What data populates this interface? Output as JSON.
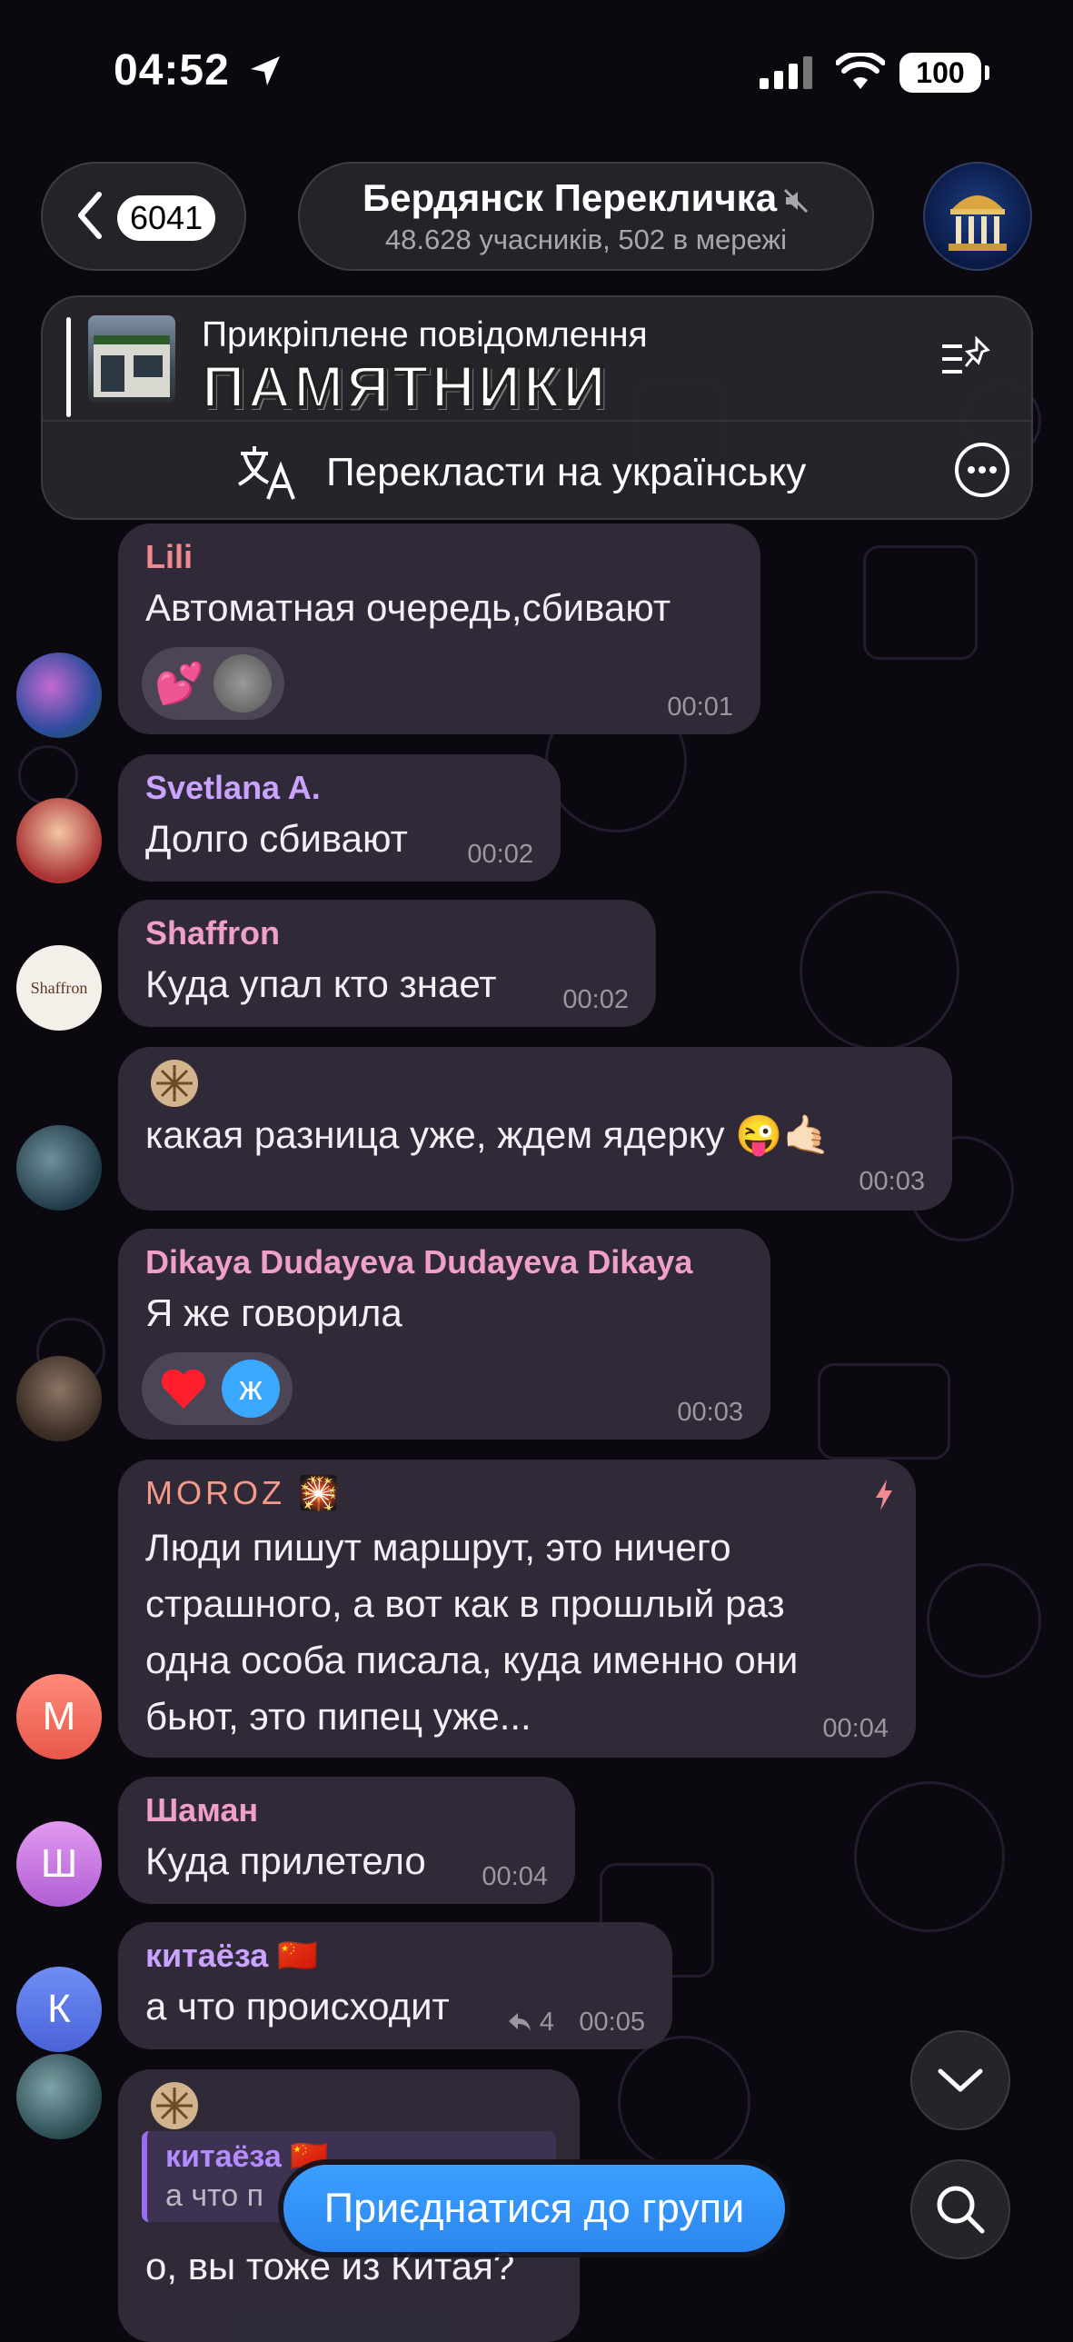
{
  "status": {
    "time": "04:52",
    "battery": "100"
  },
  "header": {
    "back_count": "6041",
    "title": "Бердянск Перекличка",
    "subtitle": "48.628 учасників, 502 в мережі"
  },
  "pinned": {
    "title": "Прикріплене повідомлення",
    "text": "ПАМЯТНИКИ",
    "translate": "Перекласти на українську"
  },
  "messages": [
    {
      "sender": "Lili",
      "text": "Автоматная очередь,сбивают",
      "time": "00:01",
      "sender_color": "#f08a8f"
    },
    {
      "sender": "Svetlana A.",
      "text": "Долго сбивают",
      "time": "00:02",
      "sender_color": "#c9a3ff"
    },
    {
      "sender": "Shaffron",
      "text": "Куда упал кто знает",
      "time": "00:02",
      "sender_color": "#f0a0c8",
      "avatar_text": "Shaffron"
    },
    {
      "sender": "",
      "text": "какая разница уже, ждем ядерку 😜🤙🏻",
      "time": "00:03"
    },
    {
      "sender": "Dikaya Dudayeva Dudayeva Dikaya",
      "text": "Я же говорила",
      "time": "00:03",
      "sender_color": "#f0a0c8",
      "reaction_letter": "ж"
    },
    {
      "sender": "MOROZ",
      "text_lines": [
        "Люди пишут маршрут, это ничего",
        "страшного, а вот как в прошлый раз",
        "одна особа писала, куда именно они",
        "бьют, это пипец уже..."
      ],
      "time": "00:04",
      "sender_color": "#f59a86",
      "avatar_letter": "M"
    },
    {
      "sender": "Шаман",
      "text": "Куда прилетело",
      "time": "00:04",
      "sender_color": "#f0a0c8",
      "avatar_letter": "Ш"
    },
    {
      "sender": "китаёза",
      "text": "а что происходит",
      "time": "00:05",
      "replies": "4",
      "sender_color": "#c9a3ff",
      "avatar_letter": "К"
    },
    {
      "quote_sender": "китаёза",
      "quote_text": "а что п",
      "text": "о, вы тоже из Китая?"
    }
  ],
  "join_button": "Приєднатися до групи",
  "colors": {
    "accent": "#2d86ef",
    "bubble": "#322c3a"
  }
}
